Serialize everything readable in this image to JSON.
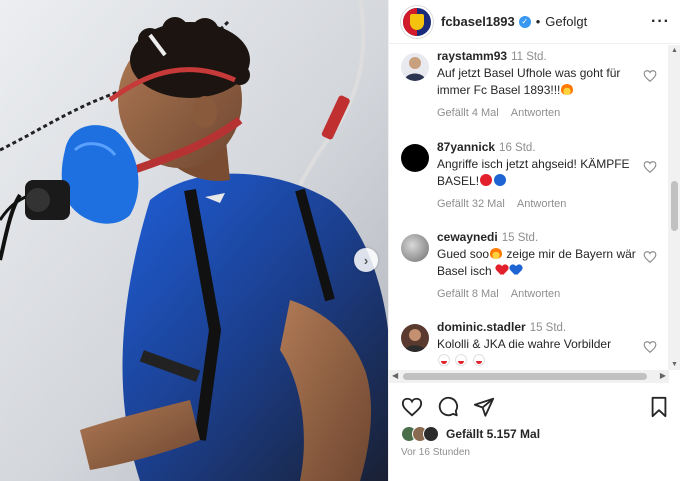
{
  "post": {
    "account": "fcbasel1893",
    "follow_state": "Gefolgt",
    "separator": "•",
    "likes_text": "Gefällt 5.157 Mal",
    "posted_ago": "Vor 16 Stunden"
  },
  "comments": [
    {
      "user": "raystamm93",
      "time": "11 Std.",
      "text": "Auf jetzt Basel Ufhole was goht für immer Fc Basel 1893!!!",
      "likes": "Gefällt 4 Mal",
      "reply": "Antworten",
      "avatar_color": "#3b4a6b"
    },
    {
      "user": "87yannick",
      "time": "16 Std.",
      "text": "Angriffe isch jetzt ahgseid! KÄMPFE BASEL!",
      "likes": "Gefällt 32 Mal",
      "reply": "Antworten",
      "avatar_color": "#000000"
    },
    {
      "user": "cewaynedi",
      "time": "15 Std.",
      "text": "Gued soo",
      "text2": "zeige mir de Bayern wär Basel isch",
      "likes": "Gefällt 8 Mal",
      "reply": "Antworten",
      "avatar_color": "#9a9a9a"
    },
    {
      "user": "dominic.stadler",
      "time": "15 Std.",
      "text": "Kololli & JKA die wahre Vorbilder",
      "avatar_color": "#5a3a2e"
    }
  ],
  "icons": {
    "heart": "heart-icon",
    "comment": "comment-icon",
    "share": "share-icon",
    "save": "bookmark-icon",
    "more": "more-icon"
  },
  "colors": {
    "brand_red": "#d11a2a",
    "brand_blue": "#1a2a7a",
    "verified_blue": "#3897f0",
    "muted_text": "#8e8e8e"
  }
}
